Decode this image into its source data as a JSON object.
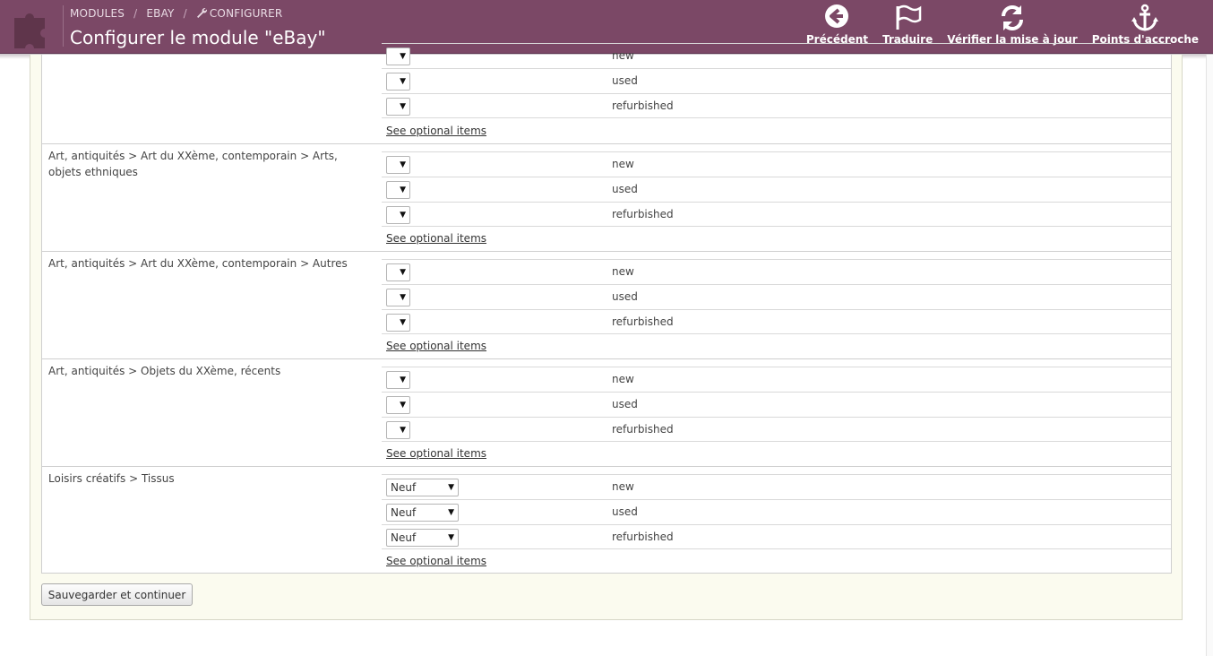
{
  "header": {
    "breadcrumb": [
      "MODULES",
      "EBAY",
      "CONFIGURER"
    ],
    "breadcrumb_sep": "/",
    "title": "Configurer le module \"eBay\"",
    "toolbar": [
      {
        "label": "Précédent",
        "icon": "back-circle-icon"
      },
      {
        "label": "Traduire",
        "icon": "flag-icon"
      },
      {
        "label": "Vérifier la mise à jour",
        "icon": "refresh-icon"
      },
      {
        "label": "Points d'accroche",
        "icon": "anchor-icon"
      }
    ],
    "colors": {
      "bar": "#7b4866"
    }
  },
  "groups": [
    {
      "category": "",
      "conditions": [
        {
          "select": "",
          "name": "new"
        },
        {
          "select": "",
          "name": "used"
        },
        {
          "select": "",
          "name": "refurbished"
        }
      ],
      "link": "See optional items"
    },
    {
      "category": "Art, antiquités > Art du XXème, contemporain > Arts, objets ethniques",
      "conditions": [
        {
          "select": "",
          "name": "new"
        },
        {
          "select": "",
          "name": "used"
        },
        {
          "select": "",
          "name": "refurbished"
        }
      ],
      "link": "See optional items"
    },
    {
      "category": "Art, antiquités > Art du XXème, contemporain > Autres",
      "conditions": [
        {
          "select": "",
          "name": "new"
        },
        {
          "select": "",
          "name": "used"
        },
        {
          "select": "",
          "name": "refurbished"
        }
      ],
      "link": "See optional items"
    },
    {
      "category": "Art, antiquités > Objets du XXème, récents",
      "conditions": [
        {
          "select": "",
          "name": "new"
        },
        {
          "select": "",
          "name": "used"
        },
        {
          "select": "",
          "name": "refurbished"
        }
      ],
      "link": "See optional items"
    },
    {
      "category": "Loisirs créatifs > Tissus",
      "conditions": [
        {
          "select": "Neuf",
          "name": "new"
        },
        {
          "select": "Neuf",
          "name": "used"
        },
        {
          "select": "Neuf",
          "name": "refurbished"
        }
      ],
      "link": "See optional items"
    }
  ],
  "save_button": "Sauvegarder et continuer"
}
